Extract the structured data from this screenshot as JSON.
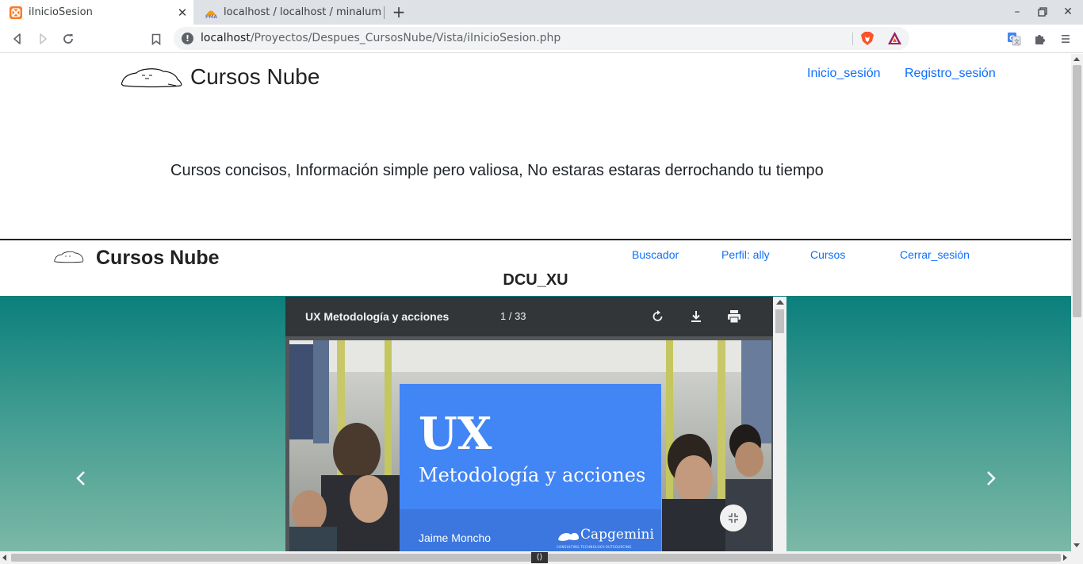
{
  "browser": {
    "tabs": [
      {
        "title": "iInicioSesion",
        "favicon": "xampp-icon",
        "active": true
      },
      {
        "title": "localhost / localhost / minalum",
        "favicon": "phpmyadmin-icon",
        "active": false
      }
    ],
    "new_tab": "+",
    "url_host": "localhost",
    "url_path": "/Proyectos/Despues_CursosNube/Vista/iInicioSesion.php"
  },
  "site_header": {
    "brand": "Cursos Nube",
    "nav": [
      "Inicio_sesión",
      "Registro_sesión"
    ],
    "tagline": "Cursos concisos, Información simple pero valiosa, No estaras estaras derrochando tu tiempo"
  },
  "embedded_header": {
    "brand": "Cursos Nube",
    "nav": [
      "Buscador",
      "Perfil: ally",
      "Cursos",
      "Cerrar_sesión"
    ],
    "course_title": "DCU_XU"
  },
  "pdf_viewer": {
    "doc_title": "UX Metodología y acciones",
    "page_indicator": "1 / 33",
    "slide": {
      "heading": "UX",
      "subheading": "Metodología y acciones",
      "author": "Jaime Moncho",
      "company": "Capgemini",
      "company_tagline": "CONSULTING.TECHNOLOGY.OUTSOURCING"
    }
  },
  "colors": {
    "link": "#0d6efd",
    "slide_card": "#4285f4",
    "carousel_top": "#0b7f7c",
    "carousel_bottom": "#7cb8a6"
  }
}
